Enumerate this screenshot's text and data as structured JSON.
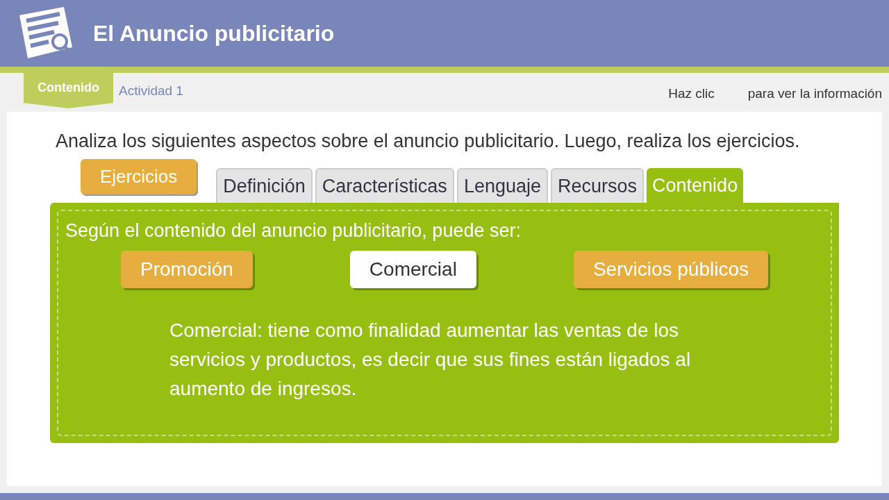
{
  "header": {
    "title": "El Anuncio publicitario"
  },
  "nav": [
    {
      "label": "Contenido",
      "selected": true
    },
    {
      "label": "Actividad 1",
      "selected": false
    }
  ],
  "hint": {
    "prefix": "Haz clic",
    "suffix": "para ver la información"
  },
  "intro": "Analiza los siguientes aspectos sobre el anuncio publicitario. Luego, realiza los ejercicios.",
  "exercises_button": "Ejercicios",
  "tabs": [
    {
      "label": "Definición",
      "selected": false
    },
    {
      "label": "Características",
      "selected": false
    },
    {
      "label": "Lenguaje",
      "selected": false
    },
    {
      "label": "Recursos",
      "selected": false
    },
    {
      "label": "Contenido",
      "selected": true
    }
  ],
  "panel": {
    "heading": "Según el contenido del anuncio publicitario, puede ser:",
    "options": [
      {
        "label": "Promoción",
        "selected": false
      },
      {
        "label": "Comercial",
        "selected": true
      },
      {
        "label": "Servicios públicos",
        "selected": false
      }
    ],
    "description": "Comercial: tiene como finalidad aumentar las ventas de los servicios y productos, es decir que sus fines están ligados al aumento de ingresos."
  }
}
